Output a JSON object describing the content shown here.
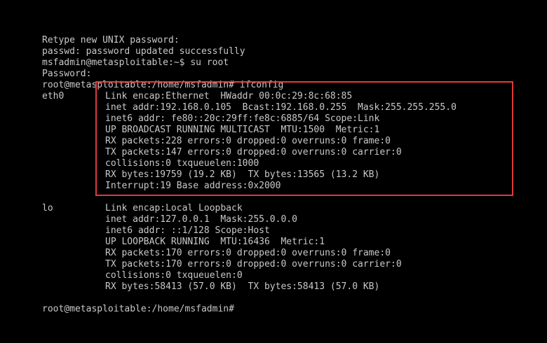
{
  "colors": {
    "background": "#000000",
    "text": "#c9c9c9",
    "highlight": "#e23a3a"
  },
  "session": [
    "Retype new UNIX password:",
    "passwd: password updated successfully",
    "msfadmin@metasploitable:~$ su root",
    "Password:",
    "root@metasploitable:/home/msfadmin# ifconfig"
  ],
  "interfaces": [
    {
      "name": "eth0",
      "lines": [
        "Link encap:Ethernet  HWaddr 00:0c:29:8c:68:85",
        "inet addr:192.168.0.105  Bcast:192.168.0.255  Mask:255.255.255.0",
        "inet6 addr: fe80::20c:29ff:fe8c:6885/64 Scope:Link",
        "UP BROADCAST RUNNING MULTICAST  MTU:1500  Metric:1",
        "RX packets:228 errors:0 dropped:0 overruns:0 frame:0",
        "TX packets:147 errors:0 dropped:0 overruns:0 carrier:0",
        "collisions:0 txqueuelen:1000",
        "RX bytes:19759 (19.2 KB)  TX bytes:13565 (13.2 KB)",
        "Interrupt:19 Base address:0x2000"
      ]
    },
    {
      "name": "lo",
      "lines": [
        "Link encap:Local Loopback",
        "inet addr:127.0.0.1  Mask:255.0.0.0",
        "inet6 addr: ::1/128 Scope:Host",
        "UP LOOPBACK RUNNING  MTU:16436  Metric:1",
        "RX packets:170 errors:0 dropped:0 overruns:0 frame:0",
        "TX packets:170 errors:0 dropped:0 overruns:0 carrier:0",
        "collisions:0 txqueuelen:0",
        "RX bytes:58413 (57.0 KB)  TX bytes:58413 (57.0 KB)"
      ]
    }
  ],
  "prompt": "root@metasploitable:/home/msfadmin#"
}
